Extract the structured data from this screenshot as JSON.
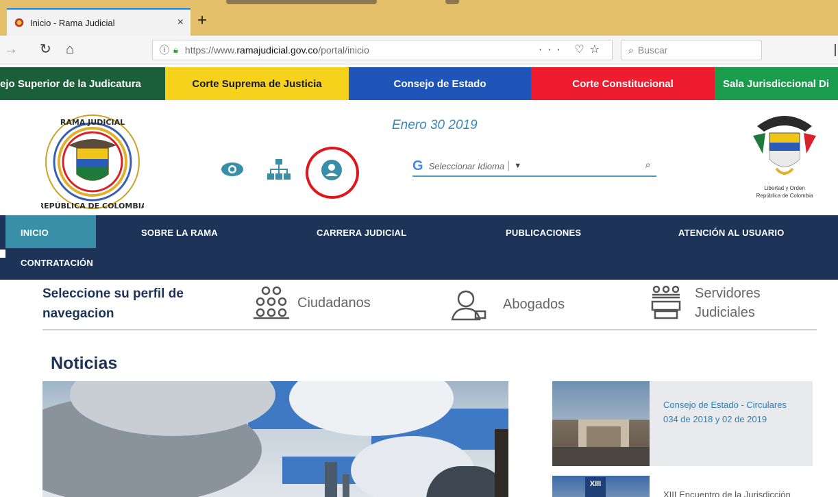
{
  "browser": {
    "tab_title": "Inicio - Rama Judicial",
    "tab_close": "×",
    "new_tab": "+",
    "url_prefix": "https://www.",
    "url_domain": "ramajudicial.gov.co",
    "url_path": "/portal/inicio",
    "url_actions": "···",
    "search_placeholder": "Buscar"
  },
  "institutions": [
    {
      "label": "ejo Superior de la Judicatura",
      "color": "#1b5e3a"
    },
    {
      "label": "Corte Suprema de Justicia",
      "color": "#f6d21d"
    },
    {
      "label": "Consejo de Estado",
      "color": "#1f55b8"
    },
    {
      "label": "Corte Constitucional",
      "color": "#ee1c2e"
    },
    {
      "label": "Sala Jurisdiccional Di",
      "color": "#199c4b"
    }
  ],
  "header": {
    "date": "Enero 30 2019",
    "translate_label": "Seleccionar Idioma",
    "translate_caret": "▼",
    "seal_text": "RAMA JUDICIAL · REPÚBLICA DE COLOMBIA",
    "coat_caption_line1": "Libertad y Orden",
    "coat_caption_line2": "República de Colombia"
  },
  "mainnav": {
    "items": [
      {
        "label": "INICIO"
      },
      {
        "label": "SOBRE LA RAMA"
      },
      {
        "label": "CARRERA JUDICIAL"
      },
      {
        "label": "PUBLICACIONES"
      },
      {
        "label": "ATENCIÓN AL USUARIO"
      },
      {
        "label": "CONTRATACIÓN"
      }
    ],
    "active": "INICIO"
  },
  "profile": {
    "title_line1": "Seleccione su perfil de",
    "title_line2": "navegacion",
    "options": [
      {
        "label": "Ciudadanos",
        "icon": "citizens-icon"
      },
      {
        "label": "Abogados",
        "icon": "lawyer-icon"
      },
      {
        "label": "Servidores",
        "label2": "Judiciales",
        "icon": "judicial-servants-icon"
      }
    ]
  },
  "news": {
    "title": "Noticias",
    "items": [
      {
        "title_line1": "Consejo de Estado - Circulares",
        "title_line2": "034 de 2018 y 02 de 2019"
      },
      {
        "title_line1": "XIII Encuentro de la Jurisdicción",
        "badge": "XIII"
      }
    ]
  }
}
